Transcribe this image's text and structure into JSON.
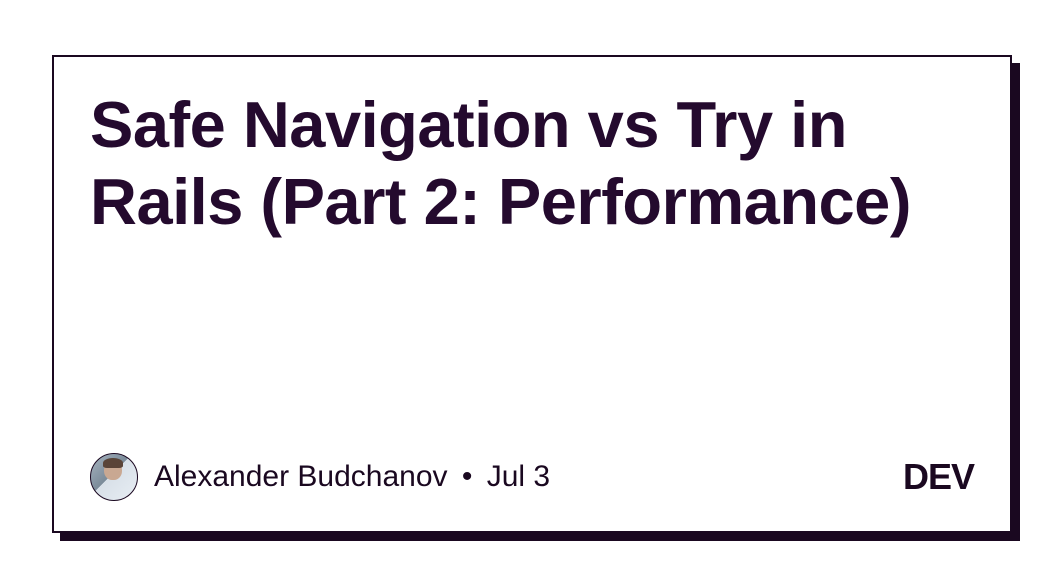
{
  "post": {
    "title": "Safe Navigation vs Try in Rails (Part 2: Performance)",
    "author": "Alexander Budchanov",
    "date": "Jul 3",
    "separator": "•"
  },
  "brand": "DEV"
}
